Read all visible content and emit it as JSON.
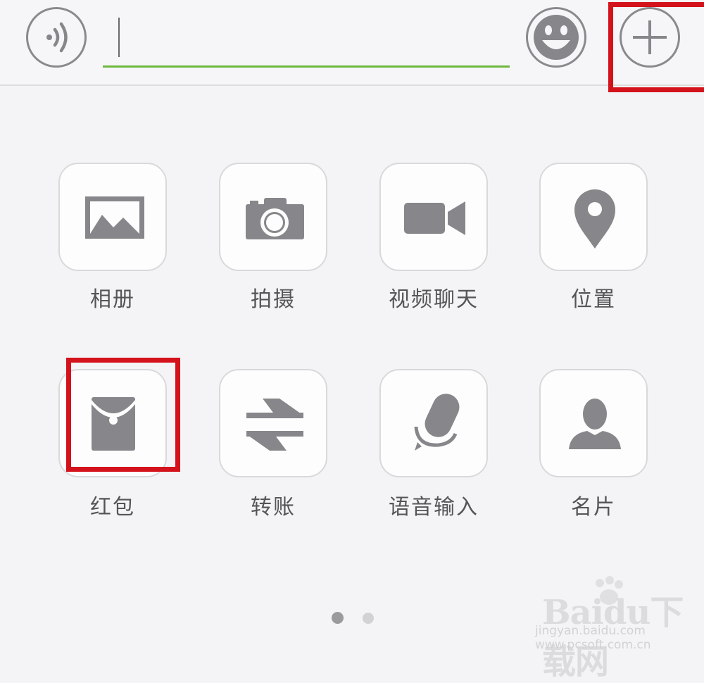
{
  "input": {
    "value": "",
    "placeholder": ""
  },
  "icons": {
    "voice": "voice-icon",
    "emoji": "emoji-icon",
    "plus": "plus-icon"
  },
  "panel": {
    "items": [
      {
        "label": "相册",
        "icon": "album-icon"
      },
      {
        "label": "拍摄",
        "icon": "camera-icon"
      },
      {
        "label": "视频聊天",
        "icon": "video-call-icon"
      },
      {
        "label": "位置",
        "icon": "location-icon"
      },
      {
        "label": "红包",
        "icon": "red-packet-icon"
      },
      {
        "label": "转账",
        "icon": "transfer-icon"
      },
      {
        "label": "语音输入",
        "icon": "microphone-icon"
      },
      {
        "label": "名片",
        "icon": "contact-card-icon"
      }
    ],
    "pages": 2,
    "current_page": 1
  },
  "colors": {
    "icon_gray": "#87878b",
    "accent_green": "#6fb83e",
    "highlight_red": "#d3121b"
  },
  "watermark": {
    "brand": "Baidu下载网",
    "site": "jingyan.baidu.com www.pcsoft.com.cn"
  }
}
